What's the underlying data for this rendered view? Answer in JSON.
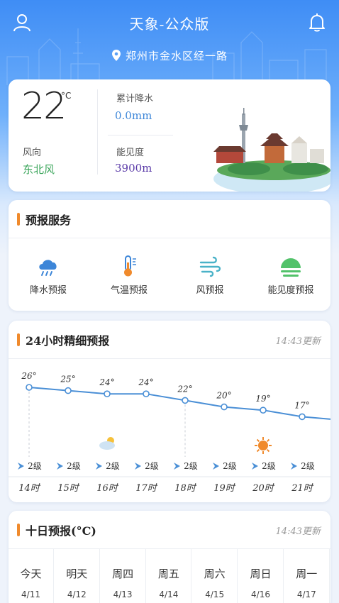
{
  "header": {
    "title": "天象-公众版",
    "location": "郑州市金水区经一路"
  },
  "current": {
    "temperature": "22",
    "unit": "°C",
    "precip_label": "累计降水",
    "precip_value": "0.0mm",
    "wind_label": "风向",
    "wind_value": "东北风",
    "visibility_label": "能见度",
    "visibility_value": "3900m"
  },
  "forecast_service": {
    "title": "预报服务",
    "items": [
      {
        "label": "降水预报",
        "icon": "rain-cloud-icon"
      },
      {
        "label": "气温预报",
        "icon": "thermometer-icon"
      },
      {
        "label": "风预报",
        "icon": "wind-icon"
      },
      {
        "label": "能见度预报",
        "icon": "visibility-icon"
      }
    ]
  },
  "hourly": {
    "title": "24小时精细预报",
    "update_time": "14:43更新",
    "temps": [
      "26°",
      "25°",
      "24°",
      "24°",
      "22°",
      "20°",
      "19°",
      "17°"
    ],
    "winds": [
      "2级",
      "2级",
      "2级",
      "2级",
      "2级",
      "2级",
      "2级",
      "2级"
    ],
    "hours": [
      "14时",
      "15时",
      "16时",
      "17时",
      "18时",
      "19时",
      "20时",
      "21时"
    ]
  },
  "tenday": {
    "title": "十日预报(°C)",
    "update_time": "14:43更新",
    "days": [
      {
        "name": "今天",
        "date": "4/11"
      },
      {
        "name": "明天",
        "date": "4/12"
      },
      {
        "name": "周四",
        "date": "4/13"
      },
      {
        "name": "周五",
        "date": "4/14"
      },
      {
        "name": "周六",
        "date": "4/15"
      },
      {
        "name": "周日",
        "date": "4/16"
      },
      {
        "name": "周一",
        "date": "4/17"
      }
    ]
  },
  "chart_data": {
    "type": "line",
    "categories": [
      "14时",
      "15时",
      "16时",
      "17时",
      "18时",
      "19时",
      "20时",
      "21时"
    ],
    "series": [
      {
        "values": [
          26,
          25,
          24,
          24,
          22,
          20,
          19,
          17
        ]
      }
    ]
  },
  "colors": {
    "header_top": "#3f8df5",
    "accent_orange": "#f08a2c",
    "line_blue": "#4a8fd6",
    "wind_green": "#3aa55a",
    "vis_purple": "#5a3aa8",
    "precip_blue": "#3d86d8"
  }
}
